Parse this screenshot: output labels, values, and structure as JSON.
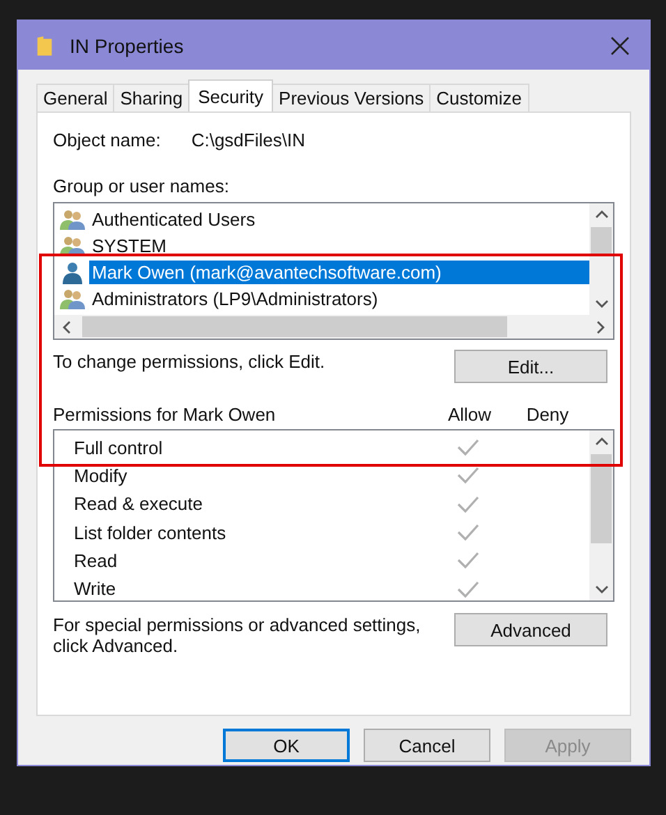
{
  "window": {
    "title": "IN Properties"
  },
  "tabs": [
    {
      "label": "General",
      "selected": false
    },
    {
      "label": "Sharing",
      "selected": false
    },
    {
      "label": "Security",
      "selected": true
    },
    {
      "label": "Previous Versions",
      "selected": false
    },
    {
      "label": "Customize",
      "selected": false
    }
  ],
  "object_name": {
    "label": "Object name:",
    "value": "C:\\gsdFiles\\IN"
  },
  "users": {
    "label": "Group or user names:",
    "items": [
      {
        "name": "Authenticated Users",
        "kind": "group",
        "selected": false
      },
      {
        "name": "SYSTEM",
        "kind": "group",
        "selected": false
      },
      {
        "name": "Mark Owen (mark@avantechsoftware.com)",
        "kind": "user",
        "selected": true
      },
      {
        "name": "Administrators (LP9\\Administrators)",
        "kind": "group",
        "selected": false
      }
    ]
  },
  "change_hint": "To change permissions, click Edit.",
  "edit_button": "Edit...",
  "permissions": {
    "title": "Permissions for Mark Owen",
    "allow_header": "Allow",
    "deny_header": "Deny",
    "rows": [
      {
        "name": "Full control",
        "allow": true,
        "deny": false
      },
      {
        "name": "Modify",
        "allow": true,
        "deny": false
      },
      {
        "name": "Read & execute",
        "allow": true,
        "deny": false
      },
      {
        "name": "List folder contents",
        "allow": true,
        "deny": false
      },
      {
        "name": "Read",
        "allow": true,
        "deny": false
      },
      {
        "name": "Write",
        "allow": true,
        "deny": false
      }
    ]
  },
  "advanced_hint": "For special permissions or advanced settings, click Advanced.",
  "advanced_button": "Advanced",
  "buttons": [
    {
      "label": "OK",
      "disabled": false,
      "default": true
    },
    {
      "label": "Cancel",
      "disabled": false,
      "default": false
    },
    {
      "label": "Apply",
      "disabled": true,
      "default": false
    }
  ]
}
